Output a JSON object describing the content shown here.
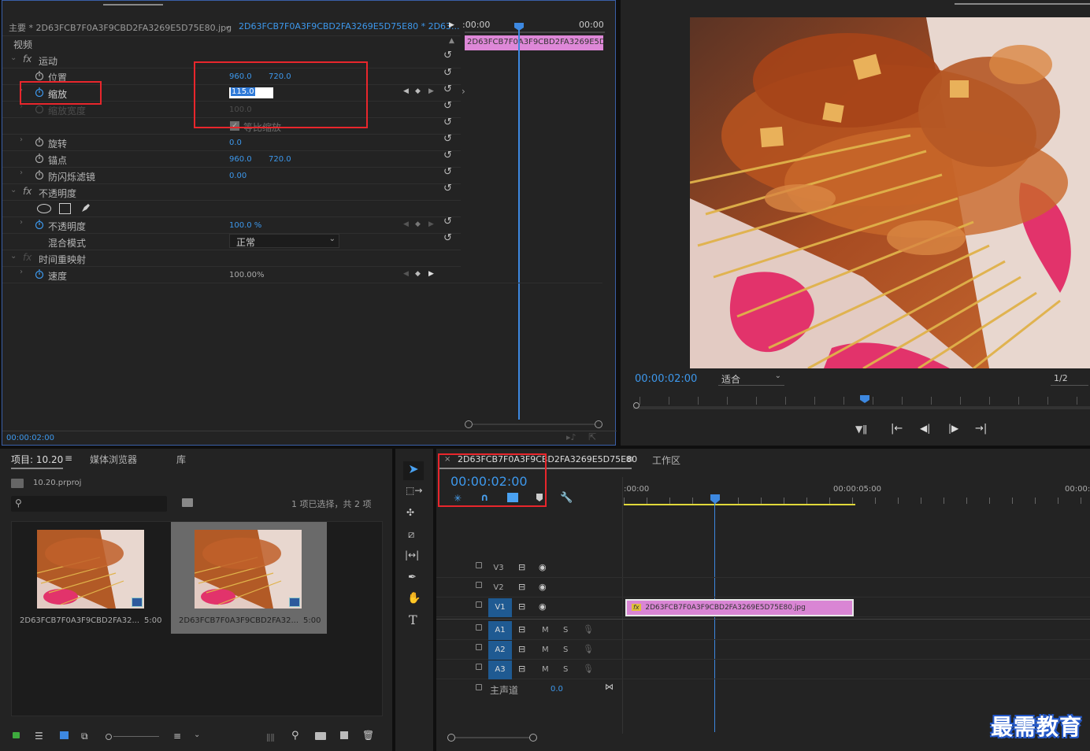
{
  "effect_controls": {
    "source_label": "主要 * 2D63FCB7F0A3F9CBD2FA3269E5D75E80.jpg",
    "clip_label": "2D63FCB7F0A3F9CBD2FA3269E5D75E80 * 2D63...",
    "timecode_start": ":00:00",
    "timecode_end": "00:00",
    "mini_clip": "2D63FCB7F0A3F9CBD2FA3269E5D",
    "section_video": "视频",
    "fx": "fx",
    "motion": "运动",
    "position": {
      "label": "位置",
      "x": "960.0",
      "y": "720.0"
    },
    "scale": {
      "label": "缩放",
      "value": "115.0"
    },
    "scale_width": {
      "label": "缩放宽度",
      "value": "100.0"
    },
    "uniform_scale": "等比缩放",
    "rotation": {
      "label": "旋转",
      "value": "0.0"
    },
    "anchor": {
      "label": "锚点",
      "x": "960.0",
      "y": "720.0"
    },
    "anti_flicker": {
      "label": "防闪烁滤镜",
      "value": "0.00"
    },
    "opacity_group": "不透明度",
    "opacity": {
      "label": "不透明度",
      "value": "100.0 %"
    },
    "blend_mode": {
      "label": "混合模式",
      "value": "正常"
    },
    "time_remap": "时间重映射",
    "speed": {
      "label": "速度",
      "value": "100.00%"
    },
    "bottom_timecode": "00:00:02:00"
  },
  "program_monitor": {
    "timecode": "00:00:02:00",
    "fit": "适合",
    "resolution": "1/2"
  },
  "project": {
    "tab_project": "项目: 10.20",
    "tab_media": "媒体浏览器",
    "tab_library": "库",
    "file": "10.20.prproj",
    "selection": "1 项已选择，共 2 项",
    "items": [
      {
        "name": "2D63FCB7F0A3F9CBD2FA32...",
        "duration": "5:00"
      },
      {
        "name": "2D63FCB7F0A3F9CBD2FA32...",
        "duration": "5:00"
      }
    ]
  },
  "timeline": {
    "tab": "2D63FCB7F0A3F9CBD2FA3269E5D75E80",
    "workspace": "工作区",
    "timecode": "00:00:02:00",
    "ruler": [
      ":00:00",
      "00:00:05:00",
      "00:00:"
    ],
    "tracks_video": [
      "V3",
      "V2",
      "V1"
    ],
    "tracks_audio": [
      "A1",
      "A2",
      "A3"
    ],
    "m": "M",
    "s": "S",
    "master": "主声道",
    "master_value": "0.0",
    "clip": "2D63FCB7F0A3F9CBD2FA3269E5D75E80.jpg",
    "clip_fx": "fx"
  },
  "watermark": "最需教育"
}
